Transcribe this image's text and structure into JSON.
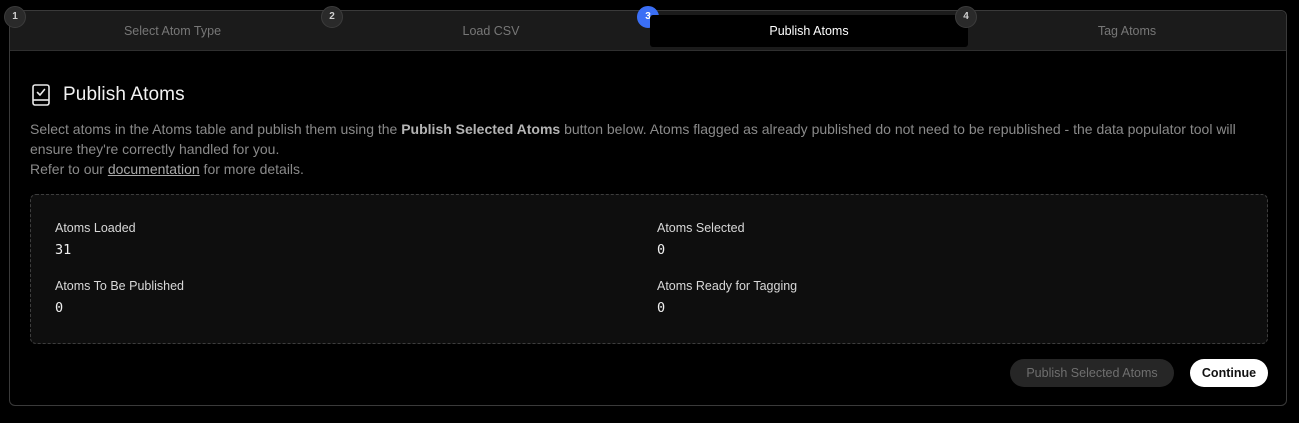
{
  "stepper": {
    "steps": [
      {
        "number": "1",
        "label": "Select Atom Type",
        "state": "inactive"
      },
      {
        "number": "2",
        "label": "Load CSV",
        "state": "inactive"
      },
      {
        "number": "3",
        "label": "Publish Atoms",
        "state": "active"
      },
      {
        "number": "4",
        "label": "Tag Atoms",
        "state": "inactive"
      }
    ]
  },
  "header": {
    "title": "Publish Atoms",
    "icon": "document-check-icon"
  },
  "description": {
    "line1_prefix": "Select atoms in the Atoms table and publish them using the ",
    "line1_bold": "Publish Selected Atoms",
    "line1_suffix": " button below. Atoms flagged as already published do not need to be republished - the data populator tool will ensure they're correctly handled for you.",
    "line2_prefix": "Refer to our ",
    "line2_link": "documentation",
    "line2_suffix": " for more details."
  },
  "stats": {
    "atoms_loaded": {
      "label": "Atoms Loaded",
      "value": "31"
    },
    "atoms_selected": {
      "label": "Atoms Selected",
      "value": "0"
    },
    "atoms_to_publish": {
      "label": "Atoms To Be Published",
      "value": "0"
    },
    "atoms_ready_tagging": {
      "label": "Atoms Ready for Tagging",
      "value": "0"
    }
  },
  "actions": {
    "publish_label": "Publish Selected Atoms",
    "publish_disabled": true,
    "continue_label": "Continue"
  },
  "colors": {
    "accent": "#3b6ff5",
    "background": "#000000",
    "stepper_bg": "#1b1b1b"
  }
}
